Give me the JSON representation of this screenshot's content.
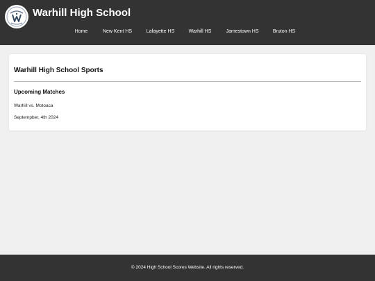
{
  "header": {
    "site_title": "Warhill High School",
    "logo_icon": "school-crest-logo",
    "background": "#333333"
  },
  "nav": {
    "items": [
      {
        "label": "Home"
      },
      {
        "label": "New Kent HS"
      },
      {
        "label": "Lafayette HS"
      },
      {
        "label": "Warhill HS"
      },
      {
        "label": "Jamestown HS"
      },
      {
        "label": "Bruton HS"
      }
    ]
  },
  "main": {
    "title": "Warhill High School Sports",
    "upcoming": {
      "heading": "Upcoming Matches",
      "matches": [
        {
          "teams": "Warhill vs. Motoaca",
          "date": "Septempber, 4th 2024"
        }
      ]
    }
  },
  "footer": {
    "copyright": "© 2024 High School Scores Website. All rights reserved."
  }
}
